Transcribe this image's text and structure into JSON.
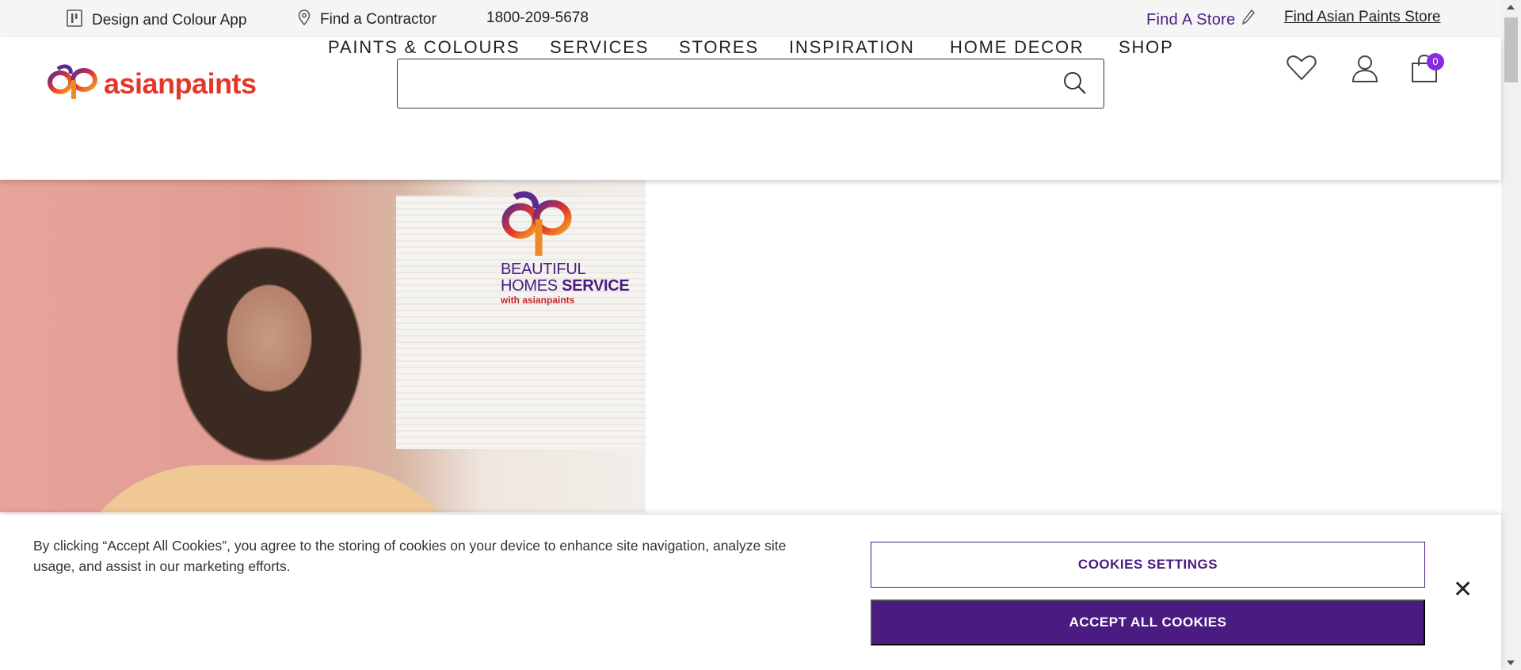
{
  "topbar": {
    "design_app": "Design and Colour App",
    "find_contractor": "Find a Contractor",
    "phone": "1800-209-5678",
    "find_store": "Find A Store",
    "find_asian_store": "Find Asian Paints Store"
  },
  "header": {
    "logo_text": "asianpaints",
    "search_placeholder": "",
    "cart_count": "0"
  },
  "nav": {
    "items": [
      "PAINTS & COLOURS",
      "SERVICES",
      "STORES",
      "INSPIRATION",
      "HOME DECOR",
      "SHOP"
    ]
  },
  "hero": {
    "brand_line1": "BEAUTIFUL",
    "brand_line2a": "HOMES ",
    "brand_line2b": "SERVICE",
    "brand_line3": "with asianpaints"
  },
  "cookie": {
    "text": "By clicking “Accept All Cookies”, you agree to the storing of cookies on your device to enhance site navigation, analyze site usage, and assist in our marketing efforts.",
    "settings_label": "COOKIES SETTINGS",
    "accept_label": "ACCEPT ALL COOKIES",
    "close_label": "✕"
  },
  "colors": {
    "brand_purple": "#4a1c82",
    "brand_red": "#e4372a",
    "badge": "#8a2be2"
  }
}
